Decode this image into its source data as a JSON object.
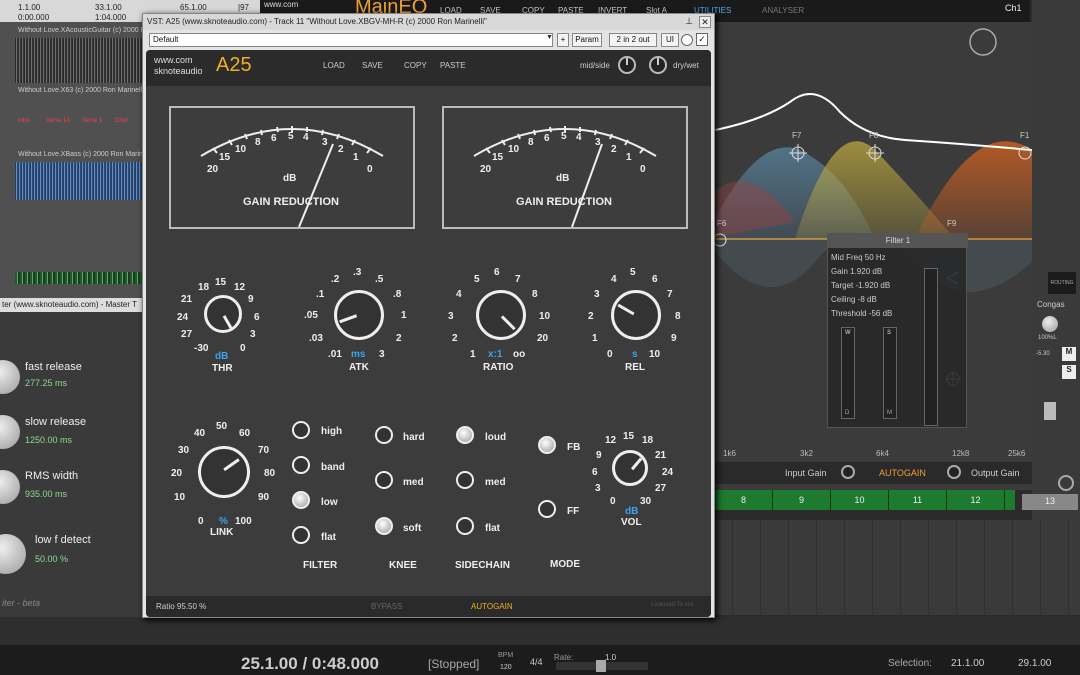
{
  "daw": {
    "ruler": [
      "1.1.00",
      "0:00.000",
      "33.1.00",
      "1:04.000",
      "65.1.00",
      "|97"
    ],
    "tracks": [
      "Without Love.XAcousticGuitar (c) 2000 Ron Marinelli",
      "Without Love.X63 (c) 2000 Ron Marinelli",
      "Without Love.XBass (c) 2000 Ron Marinelli"
    ],
    "markers": [
      "Intro",
      "Verse 1A",
      "Verse 1",
      "Chor"
    ],
    "left_window_title": "ter (www.sknoteaudio.com) - Master T",
    "left_params": [
      {
        "label": "fast release",
        "value": "277.25 ms"
      },
      {
        "label": "slow release",
        "value": "1250.00 ms"
      },
      {
        "label": "RMS width",
        "value": "935.00 ms"
      },
      {
        "label": "low f detect",
        "value": "50.00 %"
      }
    ],
    "left_footer": "iter - beta"
  },
  "topbar": {
    "site": "www.com",
    "app": "MainEQ",
    "menu": [
      "LOAD",
      "SAVE",
      "COPY",
      "PASTE",
      "INVERT",
      "Slot A",
      "UTILITIES",
      "ANALYSER"
    ],
    "channel": "Ch1"
  },
  "eq": {
    "filter_labels": [
      "F6",
      "F7",
      "F8",
      "F9",
      "F1"
    ],
    "filter_title": "Filter 1",
    "filter_lines": [
      "Mid Freq 50 Hz",
      "Gain 1.920 dB",
      "Target -1.920 dB",
      "Ceiling -8 dB",
      "Threshold -56 dB"
    ],
    "sliders": [
      {
        "top": "W",
        "bottom": "D"
      },
      {
        "top": "S",
        "bottom": "M"
      }
    ],
    "freqs": [
      "1k6",
      "3k2",
      "6k4",
      "12k8",
      "25k6"
    ],
    "input_gain": "Input Gain",
    "autogain": "AUTOGAIN",
    "output_gain": "Output Gain",
    "colors": {
      "accent": "#f0a030",
      "blue_sel": "#4aaaf0"
    }
  },
  "strip": {
    "name": "Congas",
    "routing": "ROUTING",
    "pan": "100%L",
    "level": "-5.30",
    "m": "M",
    "s": "S"
  },
  "pattern": {
    "cells": [
      "8",
      "9",
      "10",
      "11",
      "12"
    ],
    "last": "13"
  },
  "transport": {
    "time": "25.1.00 / 0:48.000",
    "state": "[Stopped]",
    "bpm_label": "BPM",
    "bpm": "120",
    "sig": "4/4",
    "rate_label": "Rate:",
    "rate": "1.0",
    "selection_label": "Selection:",
    "sel_start": "21.1.00",
    "sel_end": "29.1.00"
  },
  "plugin": {
    "title": "VST: A25 (www.sknoteaudio.com) - Track 11 \"Without Love.XBGV-MH-R (c) 2000 Ron Marinelli\"",
    "preset": "Default",
    "bar_buttons": [
      "+",
      "Param",
      "2 in 2 out",
      "UI"
    ],
    "brand_line1": "www.com",
    "brand_line2": "sknoteaudio",
    "product": "A25",
    "header_buttons": [
      "LOAD",
      "SAVE",
      "COPY",
      "PASTE"
    ],
    "midside": "mid/side",
    "drywet": "dry/wet",
    "meter_ticks": [
      "20",
      "15",
      "10",
      "8",
      "6",
      "5",
      "4",
      "3",
      "2",
      "1",
      "0"
    ],
    "meter_unit": "dB",
    "meter_label": "GAIN REDUCTION",
    "thr": {
      "ticks": [
        "18",
        "15",
        "12",
        "21",
        "9",
        "24",
        "6",
        "27",
        "3",
        "-30",
        "0"
      ],
      "unit": "dB",
      "label": "THR"
    },
    "atk": {
      "ticks": [
        ".2",
        ".3",
        ".5",
        ".1",
        ".8",
        ".05",
        "1",
        ".03",
        "2",
        ".01",
        "3"
      ],
      "unit": "ms",
      "label": "ATK"
    },
    "ratio": {
      "ticks": [
        "5",
        "6",
        "7",
        "4",
        "8",
        "3",
        "10",
        "2",
        "20",
        "1",
        "oo"
      ],
      "unit": "x:1",
      "label": "RATIO"
    },
    "rel": {
      "ticks": [
        "4",
        "5",
        "6",
        "3",
        "7",
        "2",
        "8",
        "1",
        "9",
        "0",
        "10"
      ],
      "unit": "s",
      "label": "REL"
    },
    "link": {
      "ticks": [
        "40",
        "50",
        "60",
        "30",
        "70",
        "20",
        "80",
        "10",
        "90",
        "0",
        "100"
      ],
      "unit": "%",
      "label": "LINK"
    },
    "vol": {
      "ticks": [
        "12",
        "15",
        "18",
        "9",
        "21",
        "6",
        "24",
        "3",
        "27",
        "0",
        "30"
      ],
      "unit": "dB",
      "label": "VOL"
    },
    "filter": {
      "options": [
        "high",
        "band",
        "low",
        "flat"
      ],
      "label": "FILTER",
      "selected": "low"
    },
    "knee": {
      "options": [
        "hard",
        "med",
        "soft"
      ],
      "label": "KNEE",
      "selected": "soft"
    },
    "sidechain": {
      "options": [
        "loud",
        "med",
        "flat"
      ],
      "label": "SIDECHAIN",
      "selected": "loud"
    },
    "mode": {
      "options": [
        "FB",
        "FF"
      ],
      "label": "MODE",
      "selected": "FB"
    },
    "status": "Ratio 95.50 %",
    "bypass": "BYPASS",
    "autogain": "AUTOGAIN",
    "licensed": "Licensed To xxx"
  }
}
